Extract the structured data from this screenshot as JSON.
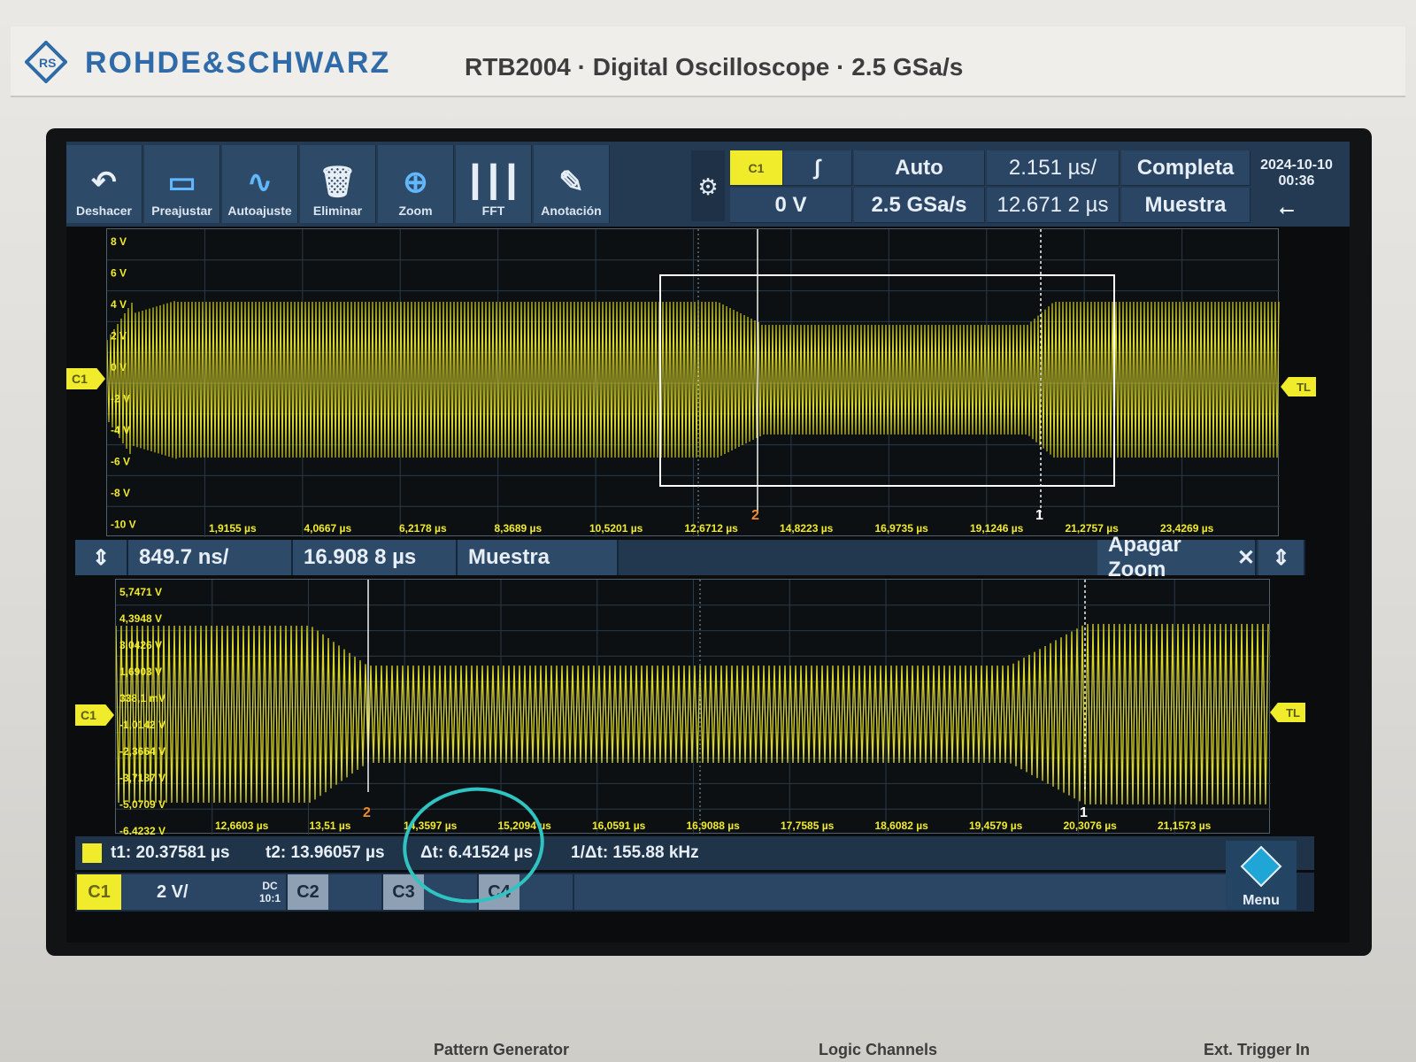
{
  "brand": {
    "name": "ROHDE&SCHWARZ",
    "model_line": "RTB2004 · Digital Oscilloscope · 2.5 GSa/s"
  },
  "toolbar": {
    "buttons": [
      {
        "label": "Deshacer",
        "icon": "undo-icon"
      },
      {
        "label": "Preajustar",
        "icon": "preset-icon"
      },
      {
        "label": "Autoajuste",
        "icon": "autoset-icon"
      },
      {
        "label": "Eliminar",
        "icon": "trash-icon"
      },
      {
        "label": "Zoom",
        "icon": "zoom-icon"
      },
      {
        "label": "FFT",
        "icon": "fft-icon"
      },
      {
        "label": "Anotación",
        "icon": "pencil-icon"
      }
    ]
  },
  "header": {
    "trigger_source": "C1",
    "trigger_level": "0 V",
    "trigger_mode": "Auto",
    "sample_rate": "2.5 GSa/s",
    "time_scale": "2.151 µs/",
    "time_position": "12.671 2 µs",
    "acquisition": "Completa",
    "acq_mode": "Muestra",
    "date": "2024-10-10",
    "time": "00:36"
  },
  "main_plot": {
    "y_labels": [
      "8 V",
      "6 V",
      "4 V",
      "2 V",
      "0 V",
      "-2 V",
      "-4 V",
      "-6 V",
      "-8 V",
      "-10 V"
    ],
    "x_labels": [
      "1,9155 µs",
      "4,0667 µs",
      "6,2178 µs",
      "8,3689 µs",
      "10,5201 µs",
      "12,6712 µs",
      "14,8223 µs",
      "16,9735 µs",
      "19,1246 µs",
      "21,2757 µs",
      "23,4269 µs"
    ],
    "channel_marker": "C1",
    "trigger_marker": "TL",
    "cursor1_label": "1",
    "cursor2_label": "2"
  },
  "zoom_bar": {
    "time_scale": "849.7 ns/",
    "position": "16.908 8 µs",
    "mode": "Muestra",
    "off_label": "Apagar Zoom"
  },
  "zoom_plot": {
    "y_labels": [
      "5,7471 V",
      "4,3948 V",
      "3,0426 V",
      "1,6903 V",
      "338,1 mV",
      "-1,0142 V",
      "-2,3664 V",
      "-3,7187 V",
      "-5,0709 V",
      "-6,4232 V"
    ],
    "x_labels": [
      "12,6603 µs",
      "13,51 µs",
      "14,3597 µs",
      "15,2094 µs",
      "16,0591 µs",
      "16,9088 µs",
      "17,7585 µs",
      "18,6082 µs",
      "19,4579 µs",
      "20,3076 µs",
      "21,1573 µs"
    ],
    "channel_marker": "C1",
    "trigger_marker": "TL"
  },
  "cursors": {
    "t1": "t1: 20.37581 µs",
    "t2": "t2: 13.96057 µs",
    "dt": "Δt: 6.41524 µs",
    "inv_dt": "1/Δt: 155.88 kHz"
  },
  "channels": {
    "c1": "C1",
    "c1_scale": "2 V/",
    "c1_coupling": "DC",
    "c1_probe": "10:1",
    "c2": "C2",
    "c3": "C3",
    "c4": "C4",
    "menu": "Menu"
  },
  "bezel_labels": {
    "pattern": "Pattern Generator",
    "logic": "Logic Channels",
    "ext": "Ext. Trigger In"
  },
  "colors": {
    "trace": "#f1ec2b",
    "toolbar": "#2d4a69",
    "brand": "#2f6ba8",
    "annotation": "#2fc4c2"
  }
}
